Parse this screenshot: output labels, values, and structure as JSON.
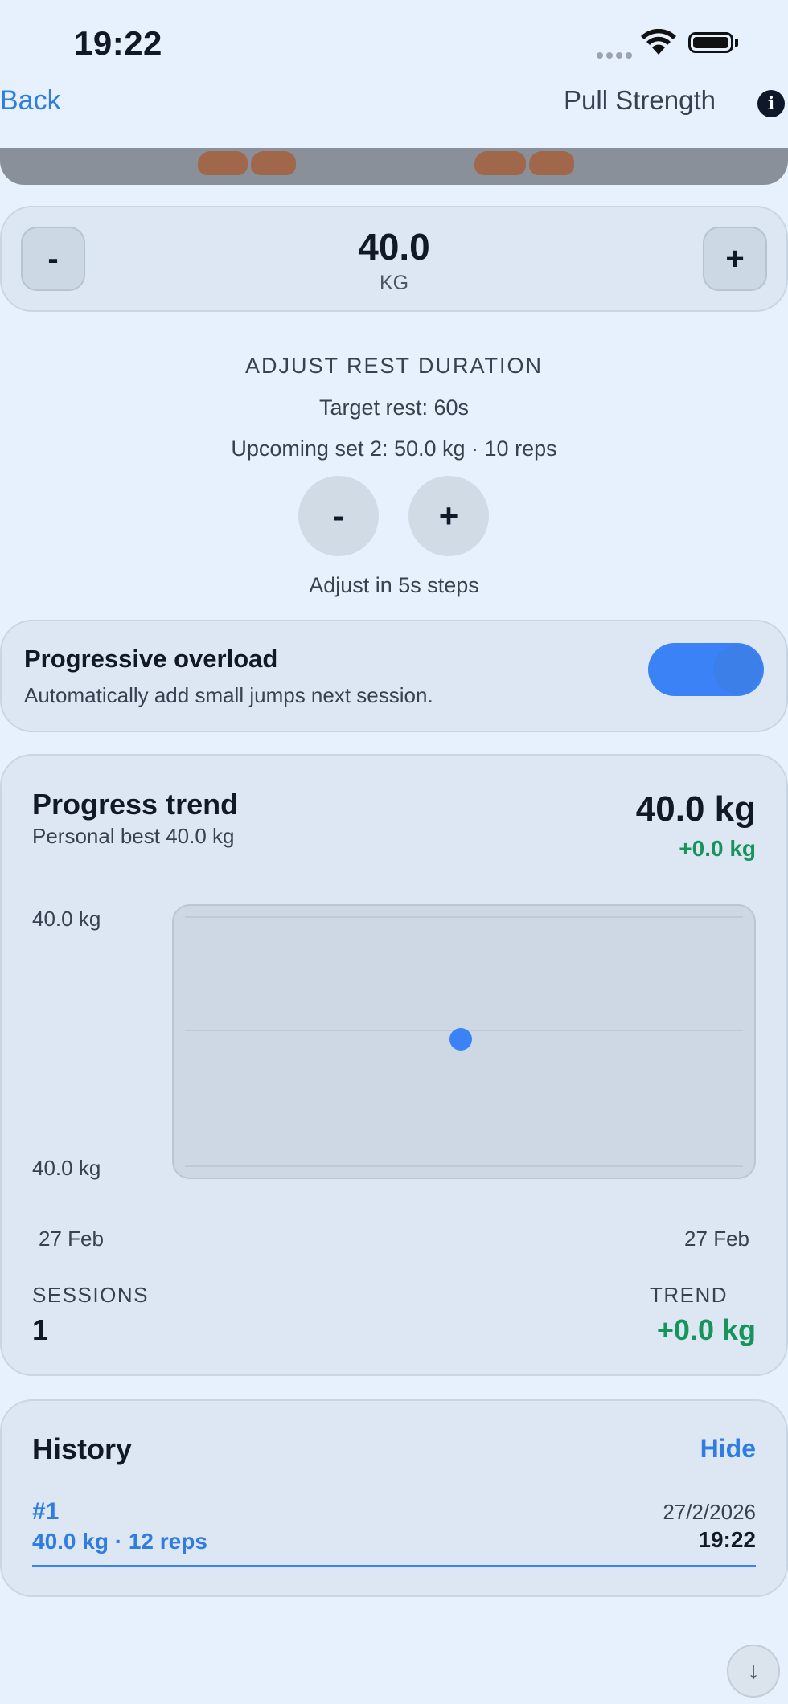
{
  "status_bar": {
    "time": "19:22",
    "icons": [
      "signal-dots-icon",
      "wifi-icon",
      "battery-icon"
    ]
  },
  "nav": {
    "back_label": "Back",
    "title": "Pull Strength",
    "info_icon": "info-icon"
  },
  "weight_stepper": {
    "minus_label": "-",
    "plus_label": "+",
    "value": "40.0",
    "unit": "KG"
  },
  "rest": {
    "heading": "ADJUST REST DURATION",
    "target": "Target rest: 60s",
    "upcoming": "Upcoming set 2: 50.0 kg · 10 reps",
    "minus_label": "-",
    "plus_label": "+",
    "step_note": "Adjust in 5s steps"
  },
  "overload": {
    "title": "Progressive overload",
    "subtitle": "Automatically add small jumps next session.",
    "enabled": true,
    "accent": "#3b82f6"
  },
  "trend": {
    "title": "Progress trend",
    "subtitle": "Personal best 40.0 kg",
    "current": "40.0 kg",
    "delta": "+0.0 kg",
    "y_top_label": "40.0 kg",
    "y_bottom_label": "40.0 kg",
    "x_left_label": "27 Feb",
    "x_right_label": "27 Feb",
    "sessions_label": "SESSIONS",
    "sessions_value": "1",
    "trend_label": "TREND",
    "trend_value": "+0.0 kg",
    "positive_color": "#16945c"
  },
  "chart_data": {
    "type": "scatter",
    "x": [
      "27 Feb"
    ],
    "series": [
      {
        "values": [
          40.0
        ]
      }
    ],
    "ylim": [
      40.0,
      40.0
    ],
    "grid": true
  },
  "history": {
    "title": "History",
    "toggle_label": "Hide",
    "entries": [
      {
        "number": "#1",
        "description": "40.0 kg · 12 reps",
        "date": "27/2/2026",
        "time": "19:22"
      }
    ]
  },
  "scroll_button": {
    "icon": "arrow-down-icon",
    "glyph": "↓"
  }
}
